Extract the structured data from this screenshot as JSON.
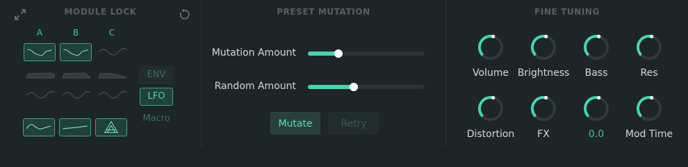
{
  "module_lock": {
    "title": "MODULE LOCK",
    "column_labels": [
      "A",
      "B",
      "C"
    ],
    "mod_buttons": [
      "ENV",
      "LFO",
      "Macro"
    ]
  },
  "preset_mutation": {
    "title": "PRESET MUTATION",
    "sliders": [
      {
        "label": "Mutation Amount",
        "value": 0.26
      },
      {
        "label": "Random Amount",
        "value": 0.39
      }
    ],
    "mutate_label": "Mutate",
    "retry_label": "Retry"
  },
  "fine_tuning": {
    "title": "FINE TUNING",
    "knobs": [
      {
        "label": "Volume",
        "value": 0.55
      },
      {
        "label": "Brightness",
        "value": 0.55
      },
      {
        "label": "Bass",
        "value": 0.55
      },
      {
        "label": "Res",
        "value": 0.55
      },
      {
        "label": "Distortion",
        "value": 0.55
      },
      {
        "label": "FX",
        "value": 0.55
      },
      {
        "label": "0.0",
        "value": 0.55
      },
      {
        "label": "Mod Time",
        "value": 0.55
      }
    ]
  },
  "colors": {
    "accent": "#4dd1b0",
    "background": "#1d2527",
    "text": "#d2d9d8"
  }
}
